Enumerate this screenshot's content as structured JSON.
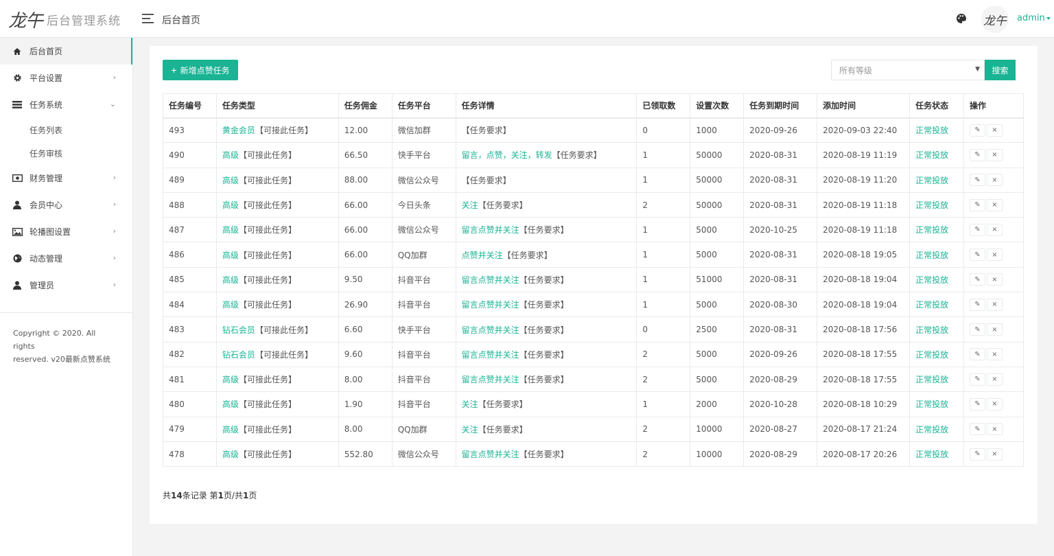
{
  "header": {
    "logo_mark": "龙午",
    "logo_text": "后台管理系统",
    "breadcrumb": "后台首页",
    "avatar_text": "龙午",
    "username": "admin"
  },
  "sidebar": {
    "items": [
      {
        "label": "后台首页",
        "icon": "home-icon",
        "arrow": ""
      },
      {
        "label": "平台设置",
        "icon": "gear-icon",
        "arrow": "›"
      },
      {
        "label": "任务系统",
        "icon": "list-icon",
        "arrow": "⌄"
      },
      {
        "label": "财务管理",
        "icon": "money-icon",
        "arrow": "›"
      },
      {
        "label": "会员中心",
        "icon": "user-icon",
        "arrow": "›"
      },
      {
        "label": "轮播图设置",
        "icon": "image-icon",
        "arrow": "›"
      },
      {
        "label": "动态管理",
        "icon": "globe-icon",
        "arrow": "›"
      },
      {
        "label": "管理员",
        "icon": "user-icon",
        "arrow": "›"
      }
    ],
    "subitems": [
      "任务列表",
      "任务审核"
    ],
    "copyright_line1": "Copyright © 2020. All rights",
    "copyright_line2": "reserved. v20最新点赞系统"
  },
  "toolbar": {
    "add_label": "新增点赞任务",
    "select_value": "所有等级",
    "search_label": "搜索"
  },
  "table": {
    "headers": [
      "任务编号",
      "任务类型",
      "任务佣金",
      "任务平台",
      "任务详情",
      "已领取数",
      "设置次数",
      "任务到期时间",
      "添加时间",
      "任务状态",
      "操作"
    ],
    "rows": [
      {
        "id": "493",
        "level": "黄金会员",
        "type_suffix": "【可接此任务】",
        "commission": "12.00",
        "platform": "微信加群",
        "detail_green": "",
        "detail": "【任务要求】",
        "received": "0",
        "count": "1000",
        "expire": "2020-09-26",
        "added": "2020-09-03 22:40",
        "status": "正常投放"
      },
      {
        "id": "490",
        "level": "高级",
        "type_suffix": "【可接此任务】",
        "commission": "66.50",
        "platform": "快手平台",
        "detail_green": "留言，点赞，关注，转发",
        "detail": "【任务要求】",
        "received": "1",
        "count": "50000",
        "expire": "2020-08-31",
        "added": "2020-08-19 11:19",
        "status": "正常投放"
      },
      {
        "id": "489",
        "level": "高级",
        "type_suffix": "【可接此任务】",
        "commission": "88.00",
        "platform": "微信公众号",
        "detail_green": "",
        "detail": "【任务要求】",
        "received": "1",
        "count": "50000",
        "expire": "2020-08-31",
        "added": "2020-08-19 11:20",
        "status": "正常投放"
      },
      {
        "id": "488",
        "level": "高级",
        "type_suffix": "【可接此任务】",
        "commission": "66.00",
        "platform": "今日头条",
        "detail_green": "关注",
        "detail": "【任务要求】",
        "received": "2",
        "count": "50000",
        "expire": "2020-08-31",
        "added": "2020-08-19 11:18",
        "status": "正常投放"
      },
      {
        "id": "487",
        "level": "高级",
        "type_suffix": "【可接此任务】",
        "commission": "66.00",
        "platform": "微信公众号",
        "detail_green": "留言点赞并关注",
        "detail": "【任务要求】",
        "received": "1",
        "count": "5000",
        "expire": "2020-10-25",
        "added": "2020-08-19 11:18",
        "status": "正常投放"
      },
      {
        "id": "486",
        "level": "高级",
        "type_suffix": "【可接此任务】",
        "commission": "66.00",
        "platform": "QQ加群",
        "detail_green": "点赞并关注",
        "detail": "【任务要求】",
        "received": "1",
        "count": "5000",
        "expire": "2020-08-31",
        "added": "2020-08-18 19:05",
        "status": "正常投放"
      },
      {
        "id": "485",
        "level": "高级",
        "type_suffix": "【可接此任务】",
        "commission": "9.50",
        "platform": "抖音平台",
        "detail_green": "留言点赞并关注",
        "detail": "【任务要求】",
        "received": "1",
        "count": "51000",
        "expire": "2020-08-31",
        "added": "2020-08-18 19:04",
        "status": "正常投放"
      },
      {
        "id": "484",
        "level": "高级",
        "type_suffix": "【可接此任务】",
        "commission": "26.90",
        "platform": "抖音平台",
        "detail_green": "留言点赞并关注",
        "detail": "【任务要求】",
        "received": "1",
        "count": "5000",
        "expire": "2020-08-30",
        "added": "2020-08-18 19:04",
        "status": "正常投放"
      },
      {
        "id": "483",
        "level": "钻石会员",
        "type_suffix": "【可接此任务】",
        "commission": "6.60",
        "platform": "快手平台",
        "detail_green": "留言点赞并关注",
        "detail": "【任务要求】",
        "received": "0",
        "count": "2500",
        "expire": "2020-08-31",
        "added": "2020-08-18 17:56",
        "status": "正常投放"
      },
      {
        "id": "482",
        "level": "钻石会员",
        "type_suffix": "【可接此任务】",
        "commission": "9.60",
        "platform": "抖音平台",
        "detail_green": "留言点赞并关注",
        "detail": "【任务要求】",
        "received": "2",
        "count": "5000",
        "expire": "2020-09-26",
        "added": "2020-08-18 17:55",
        "status": "正常投放"
      },
      {
        "id": "481",
        "level": "高级",
        "type_suffix": "【可接此任务】",
        "commission": "8.00",
        "platform": "抖音平台",
        "detail_green": "留言点赞并关注",
        "detail": "【任务要求】",
        "received": "2",
        "count": "5000",
        "expire": "2020-08-29",
        "added": "2020-08-18 17:55",
        "status": "正常投放"
      },
      {
        "id": "480",
        "level": "高级",
        "type_suffix": "【可接此任务】",
        "commission": "1.90",
        "platform": "抖音平台",
        "detail_green": "关注",
        "detail": "【任务要求】",
        "received": "1",
        "count": "2000",
        "expire": "2020-10-28",
        "added": "2020-08-18 10:29",
        "status": "正常投放"
      },
      {
        "id": "479",
        "level": "高级",
        "type_suffix": "【可接此任务】",
        "commission": "8.00",
        "platform": "QQ加群",
        "detail_green": "关注",
        "detail": "【任务要求】",
        "received": "2",
        "count": "10000",
        "expire": "2020-08-27",
        "added": "2020-08-17 21:24",
        "status": "正常投放"
      },
      {
        "id": "478",
        "level": "高级",
        "type_suffix": "【可接此任务】",
        "commission": "552.80",
        "platform": "微信公众号",
        "detail_green": "留言点赞并关注",
        "detail": "【任务要求】",
        "received": "2",
        "count": "10000",
        "expire": "2020-08-29",
        "added": "2020-08-17 20:26",
        "status": "正常投放"
      }
    ],
    "edit_icon": "✎",
    "delete_icon": "×"
  },
  "pagination": {
    "prefix": "共",
    "total": "14",
    "mid": "条记录 第",
    "page": "1",
    "mid2": "页/共",
    "pages": "1",
    "suffix": "页"
  },
  "colors": {
    "accent": "#1ab394",
    "background": "#f3f3f4"
  }
}
